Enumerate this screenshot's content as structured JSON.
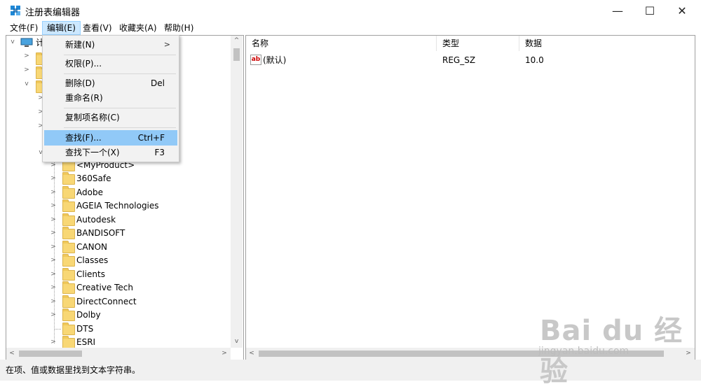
{
  "window": {
    "title": "注册表编辑器",
    "controls": {
      "minimize": "—",
      "maximize": "☐",
      "close": "✕"
    }
  },
  "menubar": [
    {
      "label": "文件(F)",
      "active": false
    },
    {
      "label": "编辑(E)",
      "active": true
    },
    {
      "label": "查看(V)",
      "active": false
    },
    {
      "label": "收藏夹(A)",
      "active": false
    },
    {
      "label": "帮助(H)",
      "active": false
    }
  ],
  "edit_menu": {
    "items": [
      {
        "label": "新建(N)",
        "shortcut": "",
        "submenu": true
      },
      {
        "label": "权限(P)...",
        "shortcut": "",
        "submenu": false
      },
      {
        "label": "删除(D)",
        "shortcut": "Del",
        "submenu": false
      },
      {
        "label": "重命名(R)",
        "shortcut": "",
        "submenu": false
      },
      {
        "label": "复制项名称(C)",
        "shortcut": "",
        "submenu": false
      },
      {
        "label": "查找(F)...",
        "shortcut": "Ctrl+F",
        "submenu": false,
        "highlighted": true
      },
      {
        "label": "查找下一个(X)",
        "shortcut": "F3",
        "submenu": false
      }
    ]
  },
  "tree": {
    "root_label": "计",
    "items": [
      "<MyProduct>",
      "360Safe",
      "Adobe",
      "AGEIA Technologies",
      "Autodesk",
      "BANDISOFT",
      "CANON",
      "Classes",
      "Clients",
      "Creative Tech",
      "DirectConnect",
      "Dolby",
      "DTS",
      "ESRI"
    ]
  },
  "values": {
    "columns": [
      "名称",
      "类型",
      "数据"
    ],
    "rows": [
      {
        "name": "(默认)",
        "type": "REG_SZ",
        "data": "10.0",
        "icon": "ab"
      }
    ]
  },
  "status": {
    "text": "在项、值或数据里找到文本字符串。"
  },
  "watermark": {
    "brand": "Bai du 经验",
    "url": "jingyan.baidu.com"
  },
  "colors": {
    "menu_highlight": "#91c9f7",
    "folder": "#f8d775"
  }
}
